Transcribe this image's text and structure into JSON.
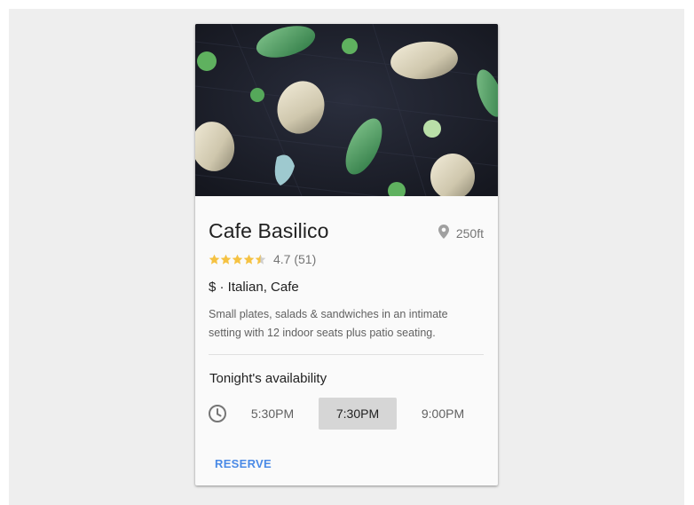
{
  "card": {
    "title": "Cafe Basilico",
    "distance": "250ft",
    "rating": {
      "value": 4.7,
      "text": "4.7 (51)",
      "stars_filled": 4.5,
      "stars_total": 5,
      "star_color": "#f5c242",
      "star_empty_color": "#cfcfcf"
    },
    "price_cuisine": "$ · Italian, Cafe",
    "description": "Small plates, salads & sandwiches in an intimate setting with 12 indoor seats plus patio seating.",
    "availability": {
      "title": "Tonight's availability",
      "slots": [
        {
          "label": "5:30PM",
          "selected": false
        },
        {
          "label": "7:30PM",
          "selected": true
        },
        {
          "label": "9:00PM",
          "selected": false
        }
      ]
    },
    "reserve_label": "RESERVE",
    "accent_color": "#4a8ae6"
  },
  "icons": {
    "location": "location-pin-icon",
    "clock": "clock-icon",
    "star": "star-icon"
  }
}
